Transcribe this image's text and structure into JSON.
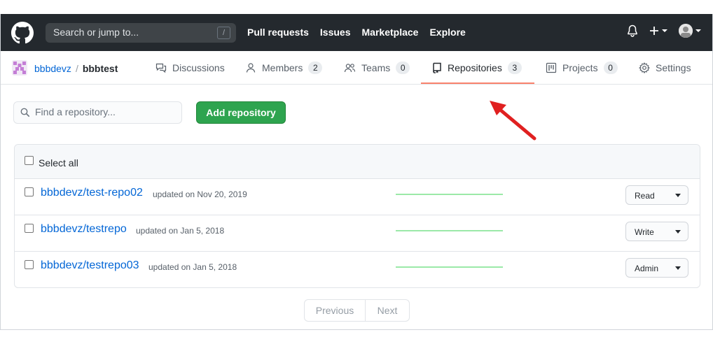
{
  "header": {
    "search_placeholder": "Search or jump to...",
    "search_shortcut": "/",
    "nav": [
      "Pull requests",
      "Issues",
      "Marketplace",
      "Explore"
    ]
  },
  "org": {
    "name": "bbbdevz",
    "separator": "/",
    "team": "bbbtest"
  },
  "tabs": [
    {
      "label": "Discussions",
      "icon": "comment-discussion-icon",
      "count": null
    },
    {
      "label": "Members",
      "icon": "person-icon",
      "count": "2"
    },
    {
      "label": "Teams",
      "icon": "people-icon",
      "count": "0"
    },
    {
      "label": "Repositories",
      "icon": "repo-icon",
      "count": "3",
      "active": true
    },
    {
      "label": "Projects",
      "icon": "project-icon",
      "count": "0"
    },
    {
      "label": "Settings",
      "icon": "gear-icon",
      "count": null
    }
  ],
  "toolbar": {
    "find_placeholder": "Find a repository...",
    "add_button": "Add repository"
  },
  "list": {
    "select_all": "Select all",
    "repos": [
      {
        "name": "bbbdevz/test-repo02",
        "updated": "updated on Nov 20, 2019",
        "permission": "Read"
      },
      {
        "name": "bbbdevz/testrepo",
        "updated": "updated on Jan 5, 2018",
        "permission": "Write"
      },
      {
        "name": "bbbdevz/testrepo03",
        "updated": "updated on Jan 5, 2018",
        "permission": "Admin"
      }
    ]
  },
  "pagination": {
    "previous": "Previous",
    "next": "Next"
  },
  "colors": {
    "header_bg": "#24292e",
    "accent_link": "#0366d6",
    "add_button": "#2ea44f",
    "active_tab_underline": "#f9826c",
    "annotation_arrow": "#e02020"
  }
}
